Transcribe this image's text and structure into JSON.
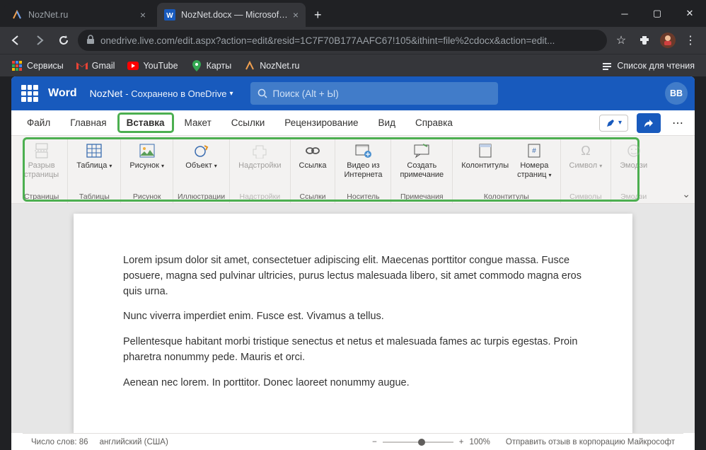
{
  "browser": {
    "tabs": [
      {
        "title": "NozNet.ru",
        "active": false
      },
      {
        "title": "NozNet.docx — Microsoft Word",
        "active": true
      }
    ],
    "url": "onedrive.live.com/edit.aspx?action=edit&resid=1C7F70B177AAFC67!105&ithint=file%2cdocx&action=edit...",
    "bookmarks": [
      {
        "label": "Сервисы",
        "icon": "apps"
      },
      {
        "label": "Gmail",
        "icon": "gmail"
      },
      {
        "label": "YouTube",
        "icon": "youtube"
      },
      {
        "label": "Карты",
        "icon": "maps"
      },
      {
        "label": "NozNet.ru",
        "icon": "noznet"
      }
    ],
    "readlist": "Список для чтения"
  },
  "word": {
    "brand": "Word",
    "doc": "NozNet",
    "saved": " - Сохранено в OneDrive",
    "searchPlaceholder": "Поиск (Alt + Ы)",
    "userInitials": "ВВ"
  },
  "tabs": {
    "file": "Файл",
    "home": "Главная",
    "insert": "Вставка",
    "layout": "Макет",
    "references": "Ссылки",
    "review": "Рецензирование",
    "view": "Вид",
    "help": "Справка"
  },
  "ribbon": {
    "groups": [
      {
        "name": "pages",
        "label": "Страницы",
        "buttons": [
          {
            "id": "page-break",
            "label": "Разрыв\nстраницы",
            "icon": "page-break",
            "disabled": true
          }
        ]
      },
      {
        "name": "tables",
        "label": "Таблицы",
        "buttons": [
          {
            "id": "table",
            "label": "Таблица",
            "icon": "table",
            "dd": true
          }
        ]
      },
      {
        "name": "picture",
        "label": "Рисунок",
        "buttons": [
          {
            "id": "picture",
            "label": "Рисунок",
            "icon": "picture",
            "dd": true
          }
        ]
      },
      {
        "name": "illustr",
        "label": "Иллюстрации",
        "buttons": [
          {
            "id": "object",
            "label": "Объект",
            "icon": "object",
            "dd": true
          }
        ]
      },
      {
        "name": "addins",
        "label": "Надстройки",
        "buttons": [
          {
            "id": "addins",
            "label": "Надстройки",
            "icon": "addins",
            "disabled": true
          }
        ],
        "disabled": true
      },
      {
        "name": "links",
        "label": "Ссылки",
        "buttons": [
          {
            "id": "link",
            "label": "Ссылка",
            "icon": "link"
          }
        ]
      },
      {
        "name": "media",
        "label": "Носитель",
        "buttons": [
          {
            "id": "video",
            "label": "Видео из\nИнтернета",
            "icon": "video"
          }
        ]
      },
      {
        "name": "comments",
        "label": "Примечания",
        "buttons": [
          {
            "id": "comment",
            "label": "Создать\nпримечание",
            "icon": "comment"
          }
        ]
      },
      {
        "name": "headers",
        "label": "Колонтитулы",
        "buttons": [
          {
            "id": "headers",
            "label": "Колонтитулы",
            "icon": "headers"
          },
          {
            "id": "pagenum",
            "label": "Номера\nстраниц",
            "icon": "pagenum",
            "dd": true
          }
        ]
      },
      {
        "name": "symbols",
        "label": "Символы",
        "buttons": [
          {
            "id": "symbol",
            "label": "Символ",
            "icon": "symbol",
            "dd": true,
            "disabled": true
          }
        ],
        "disabled": true
      },
      {
        "name": "emoji",
        "label": "Эмодзи",
        "buttons": [
          {
            "id": "emoji",
            "label": "Эмодзи",
            "icon": "emoji",
            "disabled": true
          }
        ],
        "disabled": true
      }
    ]
  },
  "document": {
    "paragraphs": [
      "Lorem ipsum dolor sit amet, consectetuer adipiscing elit. Maecenas porttitor congue massa. Fusce posuere, magna sed pulvinar ultricies, purus lectus malesuada libero, sit amet commodo magna eros quis urna.",
      "Nunc viverra imperdiet enim. Fusce est. Vivamus a tellus.",
      "Pellentesque habitant morbi tristique senectus et netus et malesuada fames ac turpis egestas. Proin pharetra nonummy pede. Mauris et orci.",
      "Aenean nec lorem. In porttitor. Donec laoreet nonummy augue."
    ]
  },
  "status": {
    "wordcount_label": "Число слов:",
    "wordcount": "86",
    "lang": "английский (США)",
    "zoom": "100%",
    "feedback": "Отправить отзыв в корпорацию Майкрософт"
  }
}
